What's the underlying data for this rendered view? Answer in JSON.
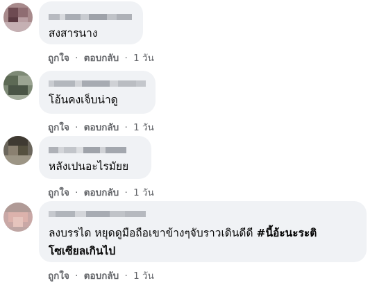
{
  "comments": [
    {
      "text": "สงสารนาง",
      "hashtag": "",
      "text2": "",
      "like_label": "ถูกใจ",
      "reply_label": "ตอบกลับ",
      "time": "1 วัน"
    },
    {
      "text": "โอ้นคงเจ็บน่าดู",
      "hashtag": "",
      "text2": "",
      "like_label": "ถูกใจ",
      "reply_label": "ตอบกลับ",
      "time": "1 วัน"
    },
    {
      "text": "หลังเปนอะไรมัยย",
      "hashtag": "",
      "text2": "",
      "like_label": "ถูกใจ",
      "reply_label": "ตอบกลับ",
      "time": "1 วัน"
    },
    {
      "text": "ลงบรรได หยุดดูมือถือเขาข้างๆจับราวเดินดีดี ",
      "hashtag": "#นี้อ้ะนะระติ",
      "text2": "โซเซียลเกินไป",
      "like_label": "ถูกใจ",
      "reply_label": "ตอบกลับ",
      "time": "1 วัน"
    }
  ],
  "separator": "·",
  "colors": {
    "bubble": "#f0f2f5",
    "text": "#050505",
    "meta": "#65676b"
  }
}
